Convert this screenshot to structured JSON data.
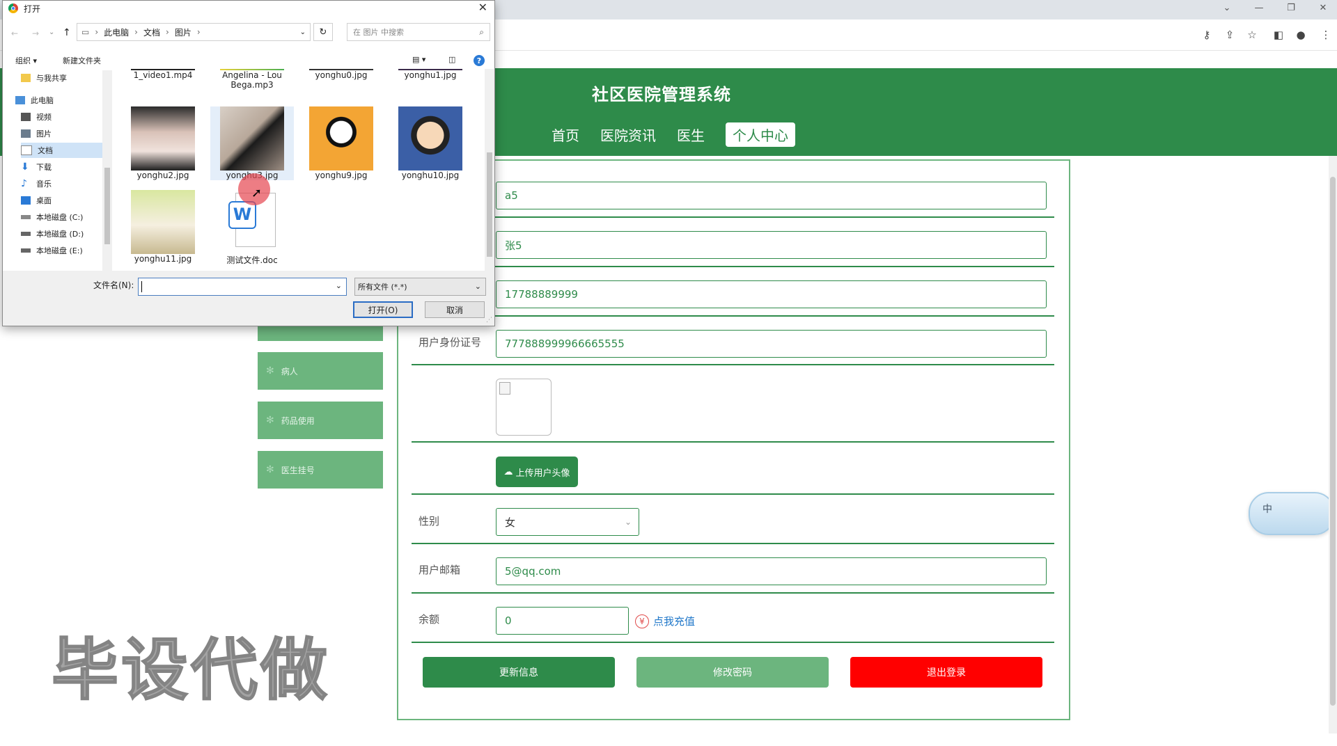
{
  "browser": {
    "window_controls": [
      "⌄",
      "—",
      "❐",
      "✕"
    ],
    "toolbar_icons": [
      "key-icon",
      "share-icon",
      "star-icon",
      "sidebar-icon",
      "profile-icon",
      "menu-icon"
    ]
  },
  "site": {
    "title": "社区医院管理系统",
    "nav": [
      "首页",
      "医院资讯",
      "医生",
      "个人中心"
    ],
    "active_nav": "个人中心",
    "sidebar": [
      "病人",
      "药品使用",
      "医生挂号"
    ]
  },
  "form": {
    "fields": {
      "username": "a5",
      "name": "张5",
      "phone": "17788889999",
      "id_label": "用户身份证号",
      "id_number": "777888999966665555",
      "gender_label": "性别",
      "gender": "女",
      "email_label": "用户邮箱",
      "email": "5@qq.com",
      "balance_label": "余额",
      "balance": "0"
    },
    "upload_label": "上传用户头像",
    "recharge_label": "点我充值",
    "buttons": {
      "update": "更新信息",
      "change_password": "修改密码",
      "logout": "退出登录"
    }
  },
  "watermark": "毕设代做",
  "float_widget": "中",
  "dialog": {
    "title": "打开",
    "path": [
      "此电脑",
      "文档",
      "图片"
    ],
    "search_placeholder": "在 图片 中搜索",
    "toolbar": {
      "organize": "组织 ▾",
      "new_folder": "新建文件夹"
    },
    "tree": [
      "与我共享",
      "此电脑",
      "视频",
      "图片",
      "文档",
      "下载",
      "音乐",
      "桌面",
      "本地磁盘 (C:)",
      "本地磁盘 (D:)",
      "本地磁盘 (E:)"
    ],
    "selected_tree": "文档",
    "files_top": [
      "1_video1.mp4",
      "Angelina - Lou Bega.mp3",
      "yonghu0.jpg",
      "yonghu1.jpg"
    ],
    "files": [
      "yonghu2.jpg",
      "yonghu3.jpg",
      "yonghu9.jpg",
      "yonghu10.jpg",
      "yonghu11.jpg",
      "测试文件.doc"
    ],
    "filename_label": "文件名(N):",
    "filename_value": "",
    "filetype": "所有文件 (*.*)",
    "open_btn": "打开(O)",
    "cancel_btn": "取消"
  },
  "colors": {
    "brand_green": "#2e8b4a",
    "light_green": "#6cb57e",
    "danger": "#ff0000"
  }
}
